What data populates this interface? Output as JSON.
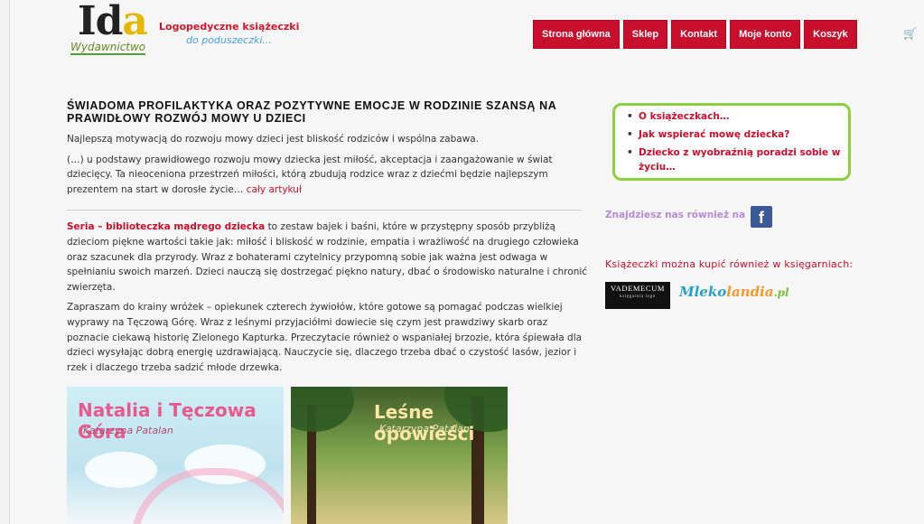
{
  "header": {
    "logo_main_prefix": "I",
    "logo_main_mid": "d",
    "logo_main_suffix": "a",
    "logo_sub": "Wydawnictwo",
    "tagline_line1": "Logopedyczne książeczki",
    "tagline_line2": "do poduszeczki...",
    "nav": [
      "Strona główna",
      "Sklep",
      "Kontakt",
      "Moje konto",
      "Koszyk"
    ],
    "cart_icon": "🛒"
  },
  "main": {
    "headline": "ŚWIADOMA PROFILAKTYKA ORAZ POZYTYWNE EMOCJE W RODZINIE SZANSĄ NA PRAWIDŁOWY ROZWÓJ MOWY U DZIECI",
    "p1": "Najlepszą motywacją do rozwoju mowy dzieci jest bliskość rodziców i wspólna zabawa.",
    "p2": "(…) u podstawy prawidłowego rozwoju mowy dziecka jest miłość, akceptacja i zaangażowanie w świat dziecięcy. Ta nieoceniona przestrzeń miłości, którą zbudują rodzice wraz z dziećmi będzie najlepszym prezentem na start w dorosłe życie…",
    "more_link": "cały artykuł",
    "series_title": "Seria – biblioteczka mądrego dziecka",
    "series_text": "to zestaw bajek i baśni, które w przystępny sposób przybliżą dzieciom piękne wartości takie jak: miłość i bliskość w rodzinie, empatia i wrażliwość na drugiego człowieka oraz szacunek dla przyrody. Wraz z bohaterami czytelnicy przypomną sobie jak ważna jest odwaga w spełnianiu swoich marzeń. Dzieci nauczą się dostrzegać piękno natury, dbać o środowisko naturalne i chronić zwierzęta.",
    "invite_text": "Zapraszam do krainy wróżek – opiekunek czterech żywiołów, które gotowe są pomagać podczas wielkiej wyprawy na Tęczową Górę. Wraz z leśnymi przyjaciółmi dowiecie się czym jest prawdziwy skarb oraz poznacie ciekawą historię Zielonego Kapturka. Przeczytacie również o wspaniałej brzozie, która śpiewała dla dzieci wysyłając dobrą energię uzdrawiającą. Nauczycie się, dlaczego trzeba dbać o czystość lasów, jezior i rzek i dlaczego trzeba sadzić młode drzewka."
  },
  "books": [
    {
      "title": "Natalia i Tęczowa Góra",
      "author": "Katarzyna Patalan"
    },
    {
      "title": "Leśne opowieści",
      "author": "Katarzyna Patalan"
    }
  ],
  "sidebar": {
    "links": [
      "O książeczkach…",
      "Jak wspierać mowę dziecka?",
      "Dziecko z wyobraźnią poradzi sobie w życiu…"
    ],
    "fb_text": "Znajdziesz nas również na",
    "fb_icon": "f",
    "stores_title": "Książeczki można kupić również w księgarniach:",
    "store1": "VADEMECUM",
    "store1_small": "księgarnia logo",
    "store2_a": "Mleko",
    "store2_b": "landia",
    "store2_c": ".pl"
  }
}
